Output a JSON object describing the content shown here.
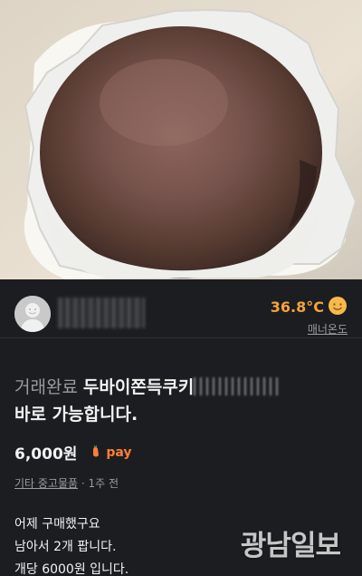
{
  "seller": {
    "name": "",
    "temperature": "36.8°C",
    "manner_label": "매너온도"
  },
  "product": {
    "status": "거래완료",
    "title": "두바이쫀득쿠키",
    "subtitle": "바로 가능합니다.",
    "price": "6,000원",
    "pay_label": "pay",
    "category": "기타 중고물품",
    "time": "1주 전",
    "description": [
      "어제 구매했구요",
      "남아서 2개 팝니다.",
      "개당 6000원 입니다."
    ]
  },
  "watermark": "광남일보",
  "colors": {
    "background": "#1c1d20",
    "temperature": "#f4a43d",
    "pay": "#ff7e36",
    "secondary_text": "#9a9ba0"
  },
  "icons": {
    "avatar": "default-avatar-icon",
    "temperature": "smiling-face-icon",
    "pay": "carrot-pay-icon"
  }
}
